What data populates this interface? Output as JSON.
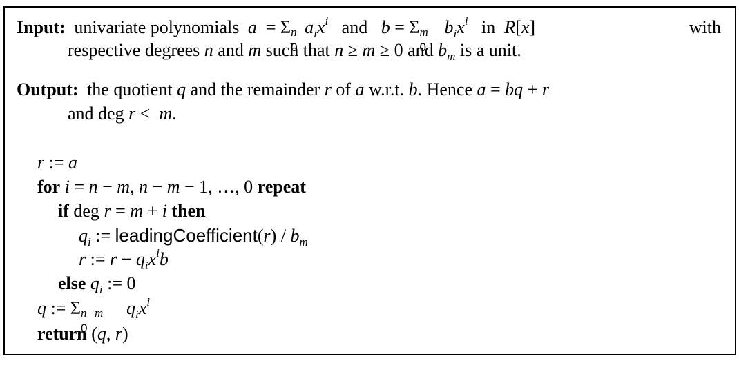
{
  "algorithm": {
    "input": {
      "label": "Input:",
      "line1_words": [
        "univariate",
        "polynomials"
      ],
      "a_def": "a = Σ",
      "a_upper": "n",
      "a_lower": "0",
      "a_term": "aᵢxⁱ",
      "conj": "and",
      "b_def": "b = Σ",
      "b_upper": "m",
      "b_lower": "0",
      "b_term": "bᵢxⁱ",
      "ring_pre": "in",
      "ring": "R[x]",
      "ring_post": "with",
      "line2": "respective degrees n and m such that n ≥ m ≥ 0 and b_m is a unit."
    },
    "output": {
      "label": "Output:",
      "line1": "the quotient q and the remainder r of a w.r.t. b. Hence a = bq + r",
      "line2": "and deg r < m."
    },
    "code": [
      "r := a",
      "for i = n − m, n − m − 1, …, 0 repeat",
      "if deg r = m + i then",
      "q_i := leadingCoefficient(r) / b_m",
      "r := r − q_i x^i b",
      "else q_i := 0",
      "q := Σ_0^{n−m} q_i x^i",
      "return (q, r)"
    ],
    "keywords": {
      "for": "for",
      "repeat": "repeat",
      "if": "if",
      "then": "then",
      "else": "else",
      "return": "return"
    },
    "function_name": "leadingCoefficient",
    "deg": "deg"
  }
}
